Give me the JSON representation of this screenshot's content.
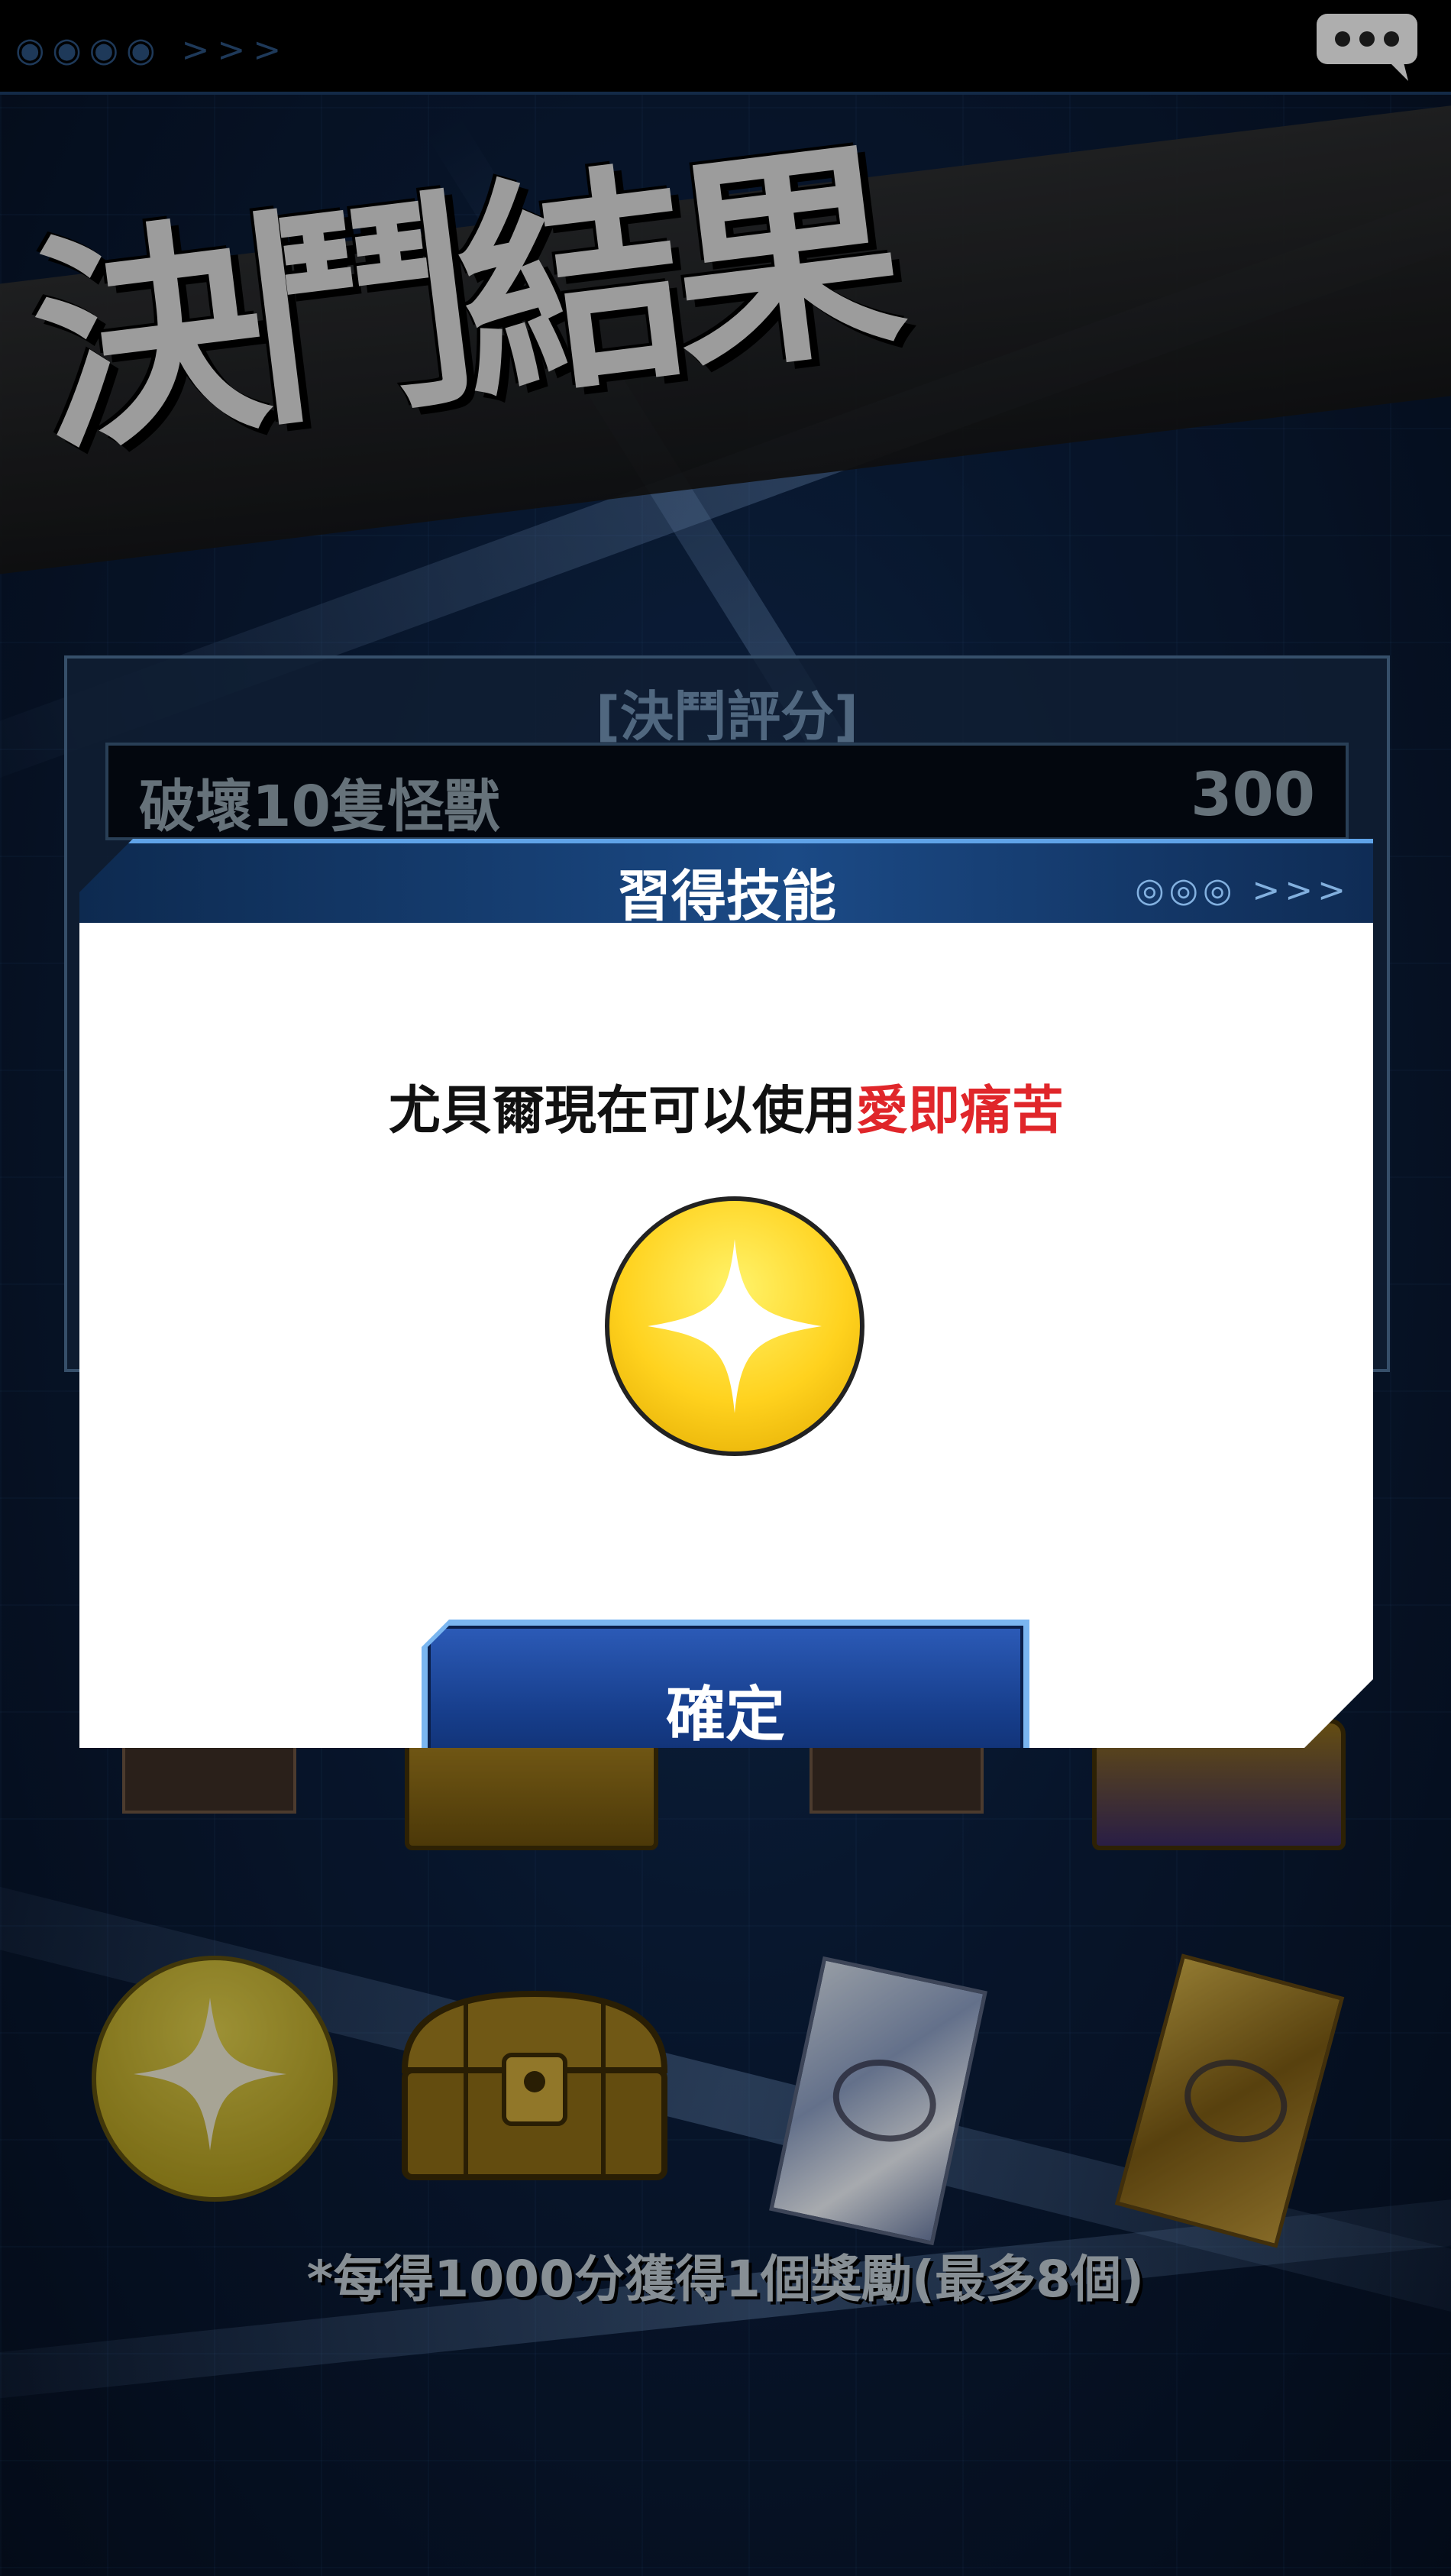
{
  "page": {
    "title": "決鬥結果"
  },
  "score_panel": {
    "header": "[決鬥評分]",
    "rows": [
      {
        "label": "破壞10隻怪獸",
        "value": "300"
      }
    ]
  },
  "rewards": {
    "items": [
      "skill-coin-icon",
      "treasure-chest-icon",
      "card-pack-icon",
      "gold-card-pack-icon"
    ],
    "note": "*每得1000分獲得1個獎勵(最多8個)"
  },
  "modal": {
    "title": "習得技能",
    "message_prefix": "尤貝爾現在可以使用",
    "message_highlight": "愛即痛苦",
    "highlight_color": "#e0262a",
    "icon": "skill-star-icon",
    "confirm_label": "確定"
  },
  "topbar": {
    "chat_icon": "chat-bubble-icon"
  }
}
